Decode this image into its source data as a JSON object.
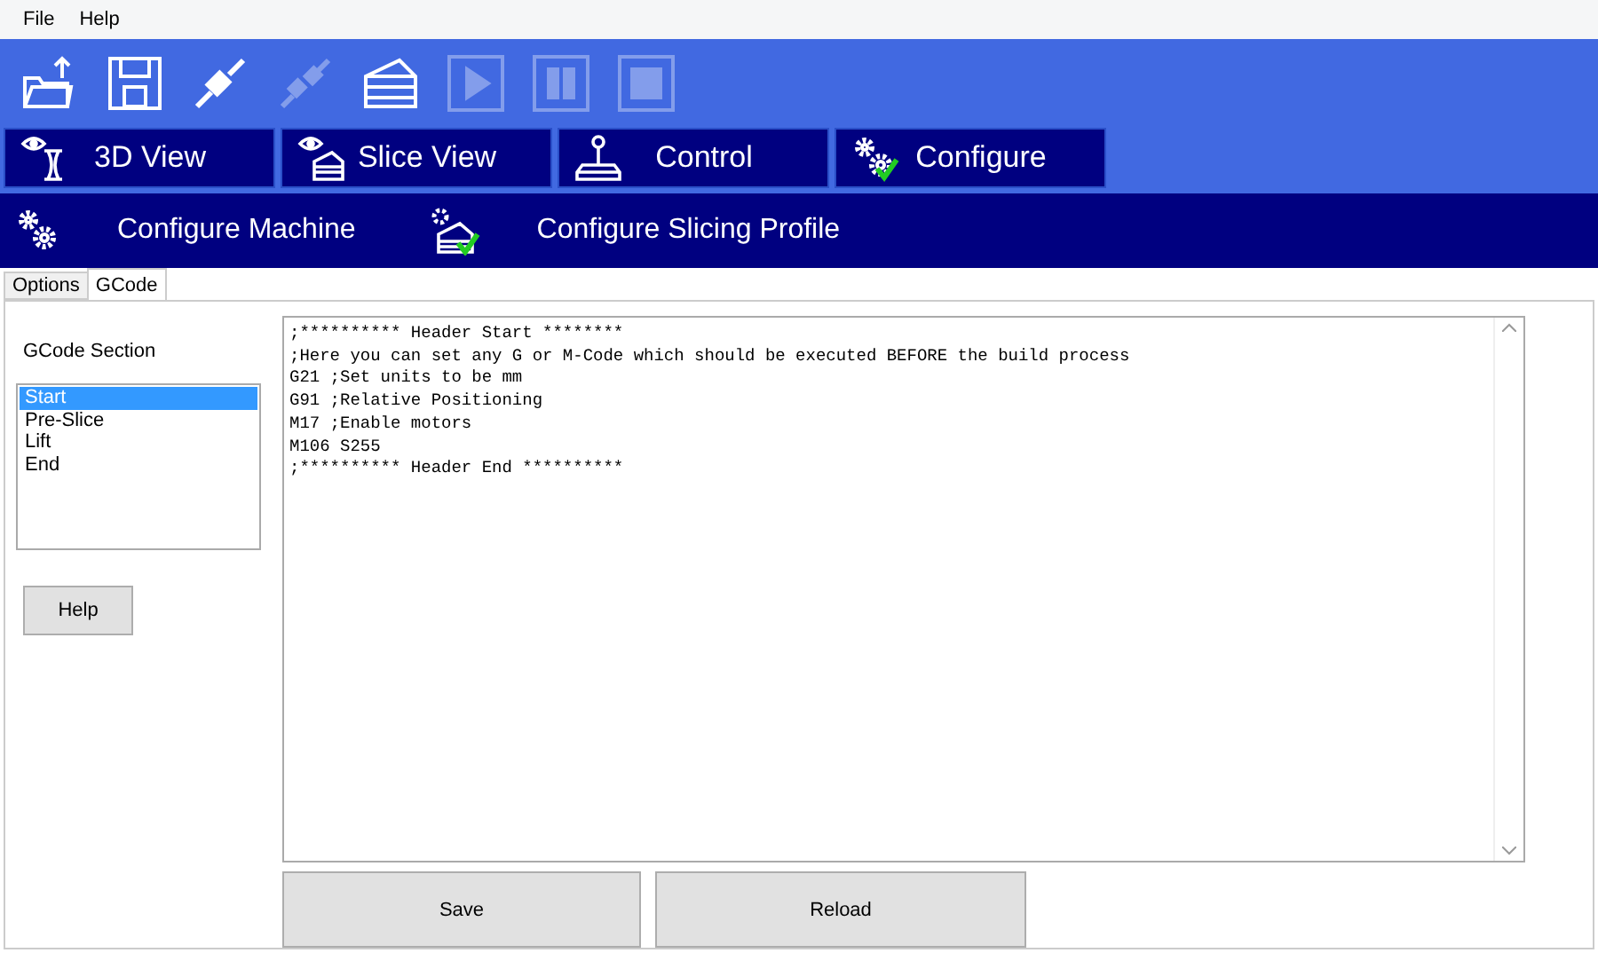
{
  "menu": [
    "File",
    "Help"
  ],
  "toolbar": [
    {
      "kind": "open",
      "disabled": false
    },
    {
      "kind": "save",
      "disabled": false
    },
    {
      "kind": "connect",
      "disabled": false
    },
    {
      "kind": "disconnect",
      "disabled": true
    },
    {
      "kind": "slice",
      "disabled": false
    },
    {
      "kind": "play",
      "disabled": true
    },
    {
      "kind": "pause",
      "disabled": true
    },
    {
      "kind": "stop",
      "disabled": true
    }
  ],
  "main_tabs": [
    {
      "label": "3D View",
      "kind": "view3d"
    },
    {
      "label": "Slice View",
      "kind": "slice"
    },
    {
      "label": "Control",
      "kind": "control"
    },
    {
      "label": "Configure",
      "kind": "configure"
    }
  ],
  "sub_nav": [
    {
      "label": "Configure Machine",
      "kind": "gears"
    },
    {
      "label": "Configure Slicing Profile",
      "kind": "profile"
    }
  ],
  "tabs": [
    {
      "label": "Options",
      "selected": false
    },
    {
      "label": "GCode",
      "selected": true
    }
  ],
  "section_label": "GCode Section",
  "sections": [
    {
      "label": "Start",
      "selected": true
    },
    {
      "label": "Pre-Slice",
      "selected": false
    },
    {
      "label": "Lift",
      "selected": false
    },
    {
      "label": "End",
      "selected": false
    }
  ],
  "help_button": "Help",
  "gcode": [
    ";********** Header Start ********",
    ";Here you can set any G or M-Code which should be executed BEFORE the build process",
    "G21 ;Set units to be mm",
    "G91 ;Relative Positioning",
    "M17 ;Enable motors",
    "M106 S255",
    ";********** Header End **********"
  ],
  "buttons": [
    "Save",
    "Reload"
  ]
}
